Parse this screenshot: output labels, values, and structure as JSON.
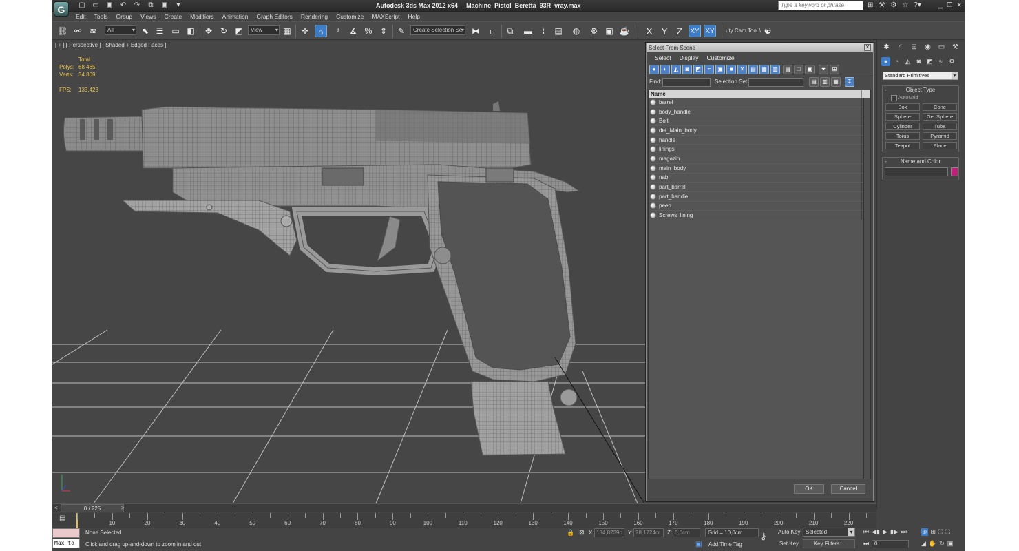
{
  "title_bar": {
    "app_name": "Autodesk 3ds Max  2012 x64",
    "file_name": "Machine_Pistol_Beretta_93R_vray.max",
    "search_placeholder": "Type a keyword or phrase"
  },
  "menus": [
    "Edit",
    "Tools",
    "Group",
    "Views",
    "Create",
    "Modifiers",
    "Animation",
    "Graph Editors",
    "Rendering",
    "Customize",
    "MAXScript",
    "Help"
  ],
  "toolbar": {
    "filter_value": "All",
    "coord_value": "View",
    "selection_set_placeholder": "Create Selection Se",
    "axis_x": "X",
    "axis_y": "Y",
    "axis_z": "Z",
    "axis_xy": "XY",
    "axis_xy2": "XY",
    "cam_tool": "uty Cam Tool \\"
  },
  "viewport": {
    "label": "[ + ] [ Perspective ] [ Shaded + Edged Faces ]",
    "stats_header": "Total",
    "polys_label": "Polys:",
    "polys_value": "68 465",
    "verts_label": "Verts:",
    "verts_value": "34 809",
    "fps_label": "FPS:",
    "fps_value": "133,423"
  },
  "dialog": {
    "title": "Select From Scene",
    "menus": [
      "Select",
      "Display",
      "Customize"
    ],
    "find_label": "Find:",
    "selection_set_label": "Selection Set:",
    "column_name": "Name",
    "items": [
      "barrel",
      "body_handle",
      "Bolt",
      "det_Main_body",
      "handle",
      "linings",
      "magazin",
      "main_body",
      "nab",
      "part_barrel",
      "part_handle",
      "peen",
      "Screws_lining"
    ],
    "ok_label": "OK",
    "cancel_label": "Cancel"
  },
  "command_panel": {
    "category": "Standard Primitives",
    "object_type_title": "Object Type",
    "autogrid_label": "AutoGrid",
    "object_buttons": [
      "Box",
      "Cone",
      "Sphere",
      "GeoSphere",
      "Cylinder",
      "Tube",
      "Torus",
      "Pyramid",
      "Teapot",
      "Plane"
    ],
    "name_color_title": "Name and Color",
    "object_color": "#c4227a"
  },
  "timeline": {
    "frame_indicator": "0 / 225",
    "left_arrow": "<",
    "right_arrow": ">",
    "tick_labels": [
      "10",
      "20",
      "30",
      "40",
      "50",
      "60",
      "70",
      "80",
      "90",
      "100",
      "110",
      "120",
      "130",
      "140",
      "150",
      "160",
      "170",
      "180",
      "190",
      "200",
      "210",
      "220"
    ]
  },
  "status": {
    "selection": "None Selected",
    "prompt": "Click and drag up-and-down to zoom in and out",
    "maxscript_label": "Max to",
    "x_label": "X:",
    "x_value": "134,8739c",
    "y_label": "Y:",
    "y_value": "28,1724cr",
    "z_label": "Z:",
    "z_value": "0,0cm",
    "grid": "Grid = 10,0cm",
    "add_time_tag": "Add Time Tag",
    "auto_key": "Auto Key",
    "selected": "Selected",
    "set_key": "Set Key",
    "key_filters": "Key Filters...",
    "frame": "0"
  }
}
